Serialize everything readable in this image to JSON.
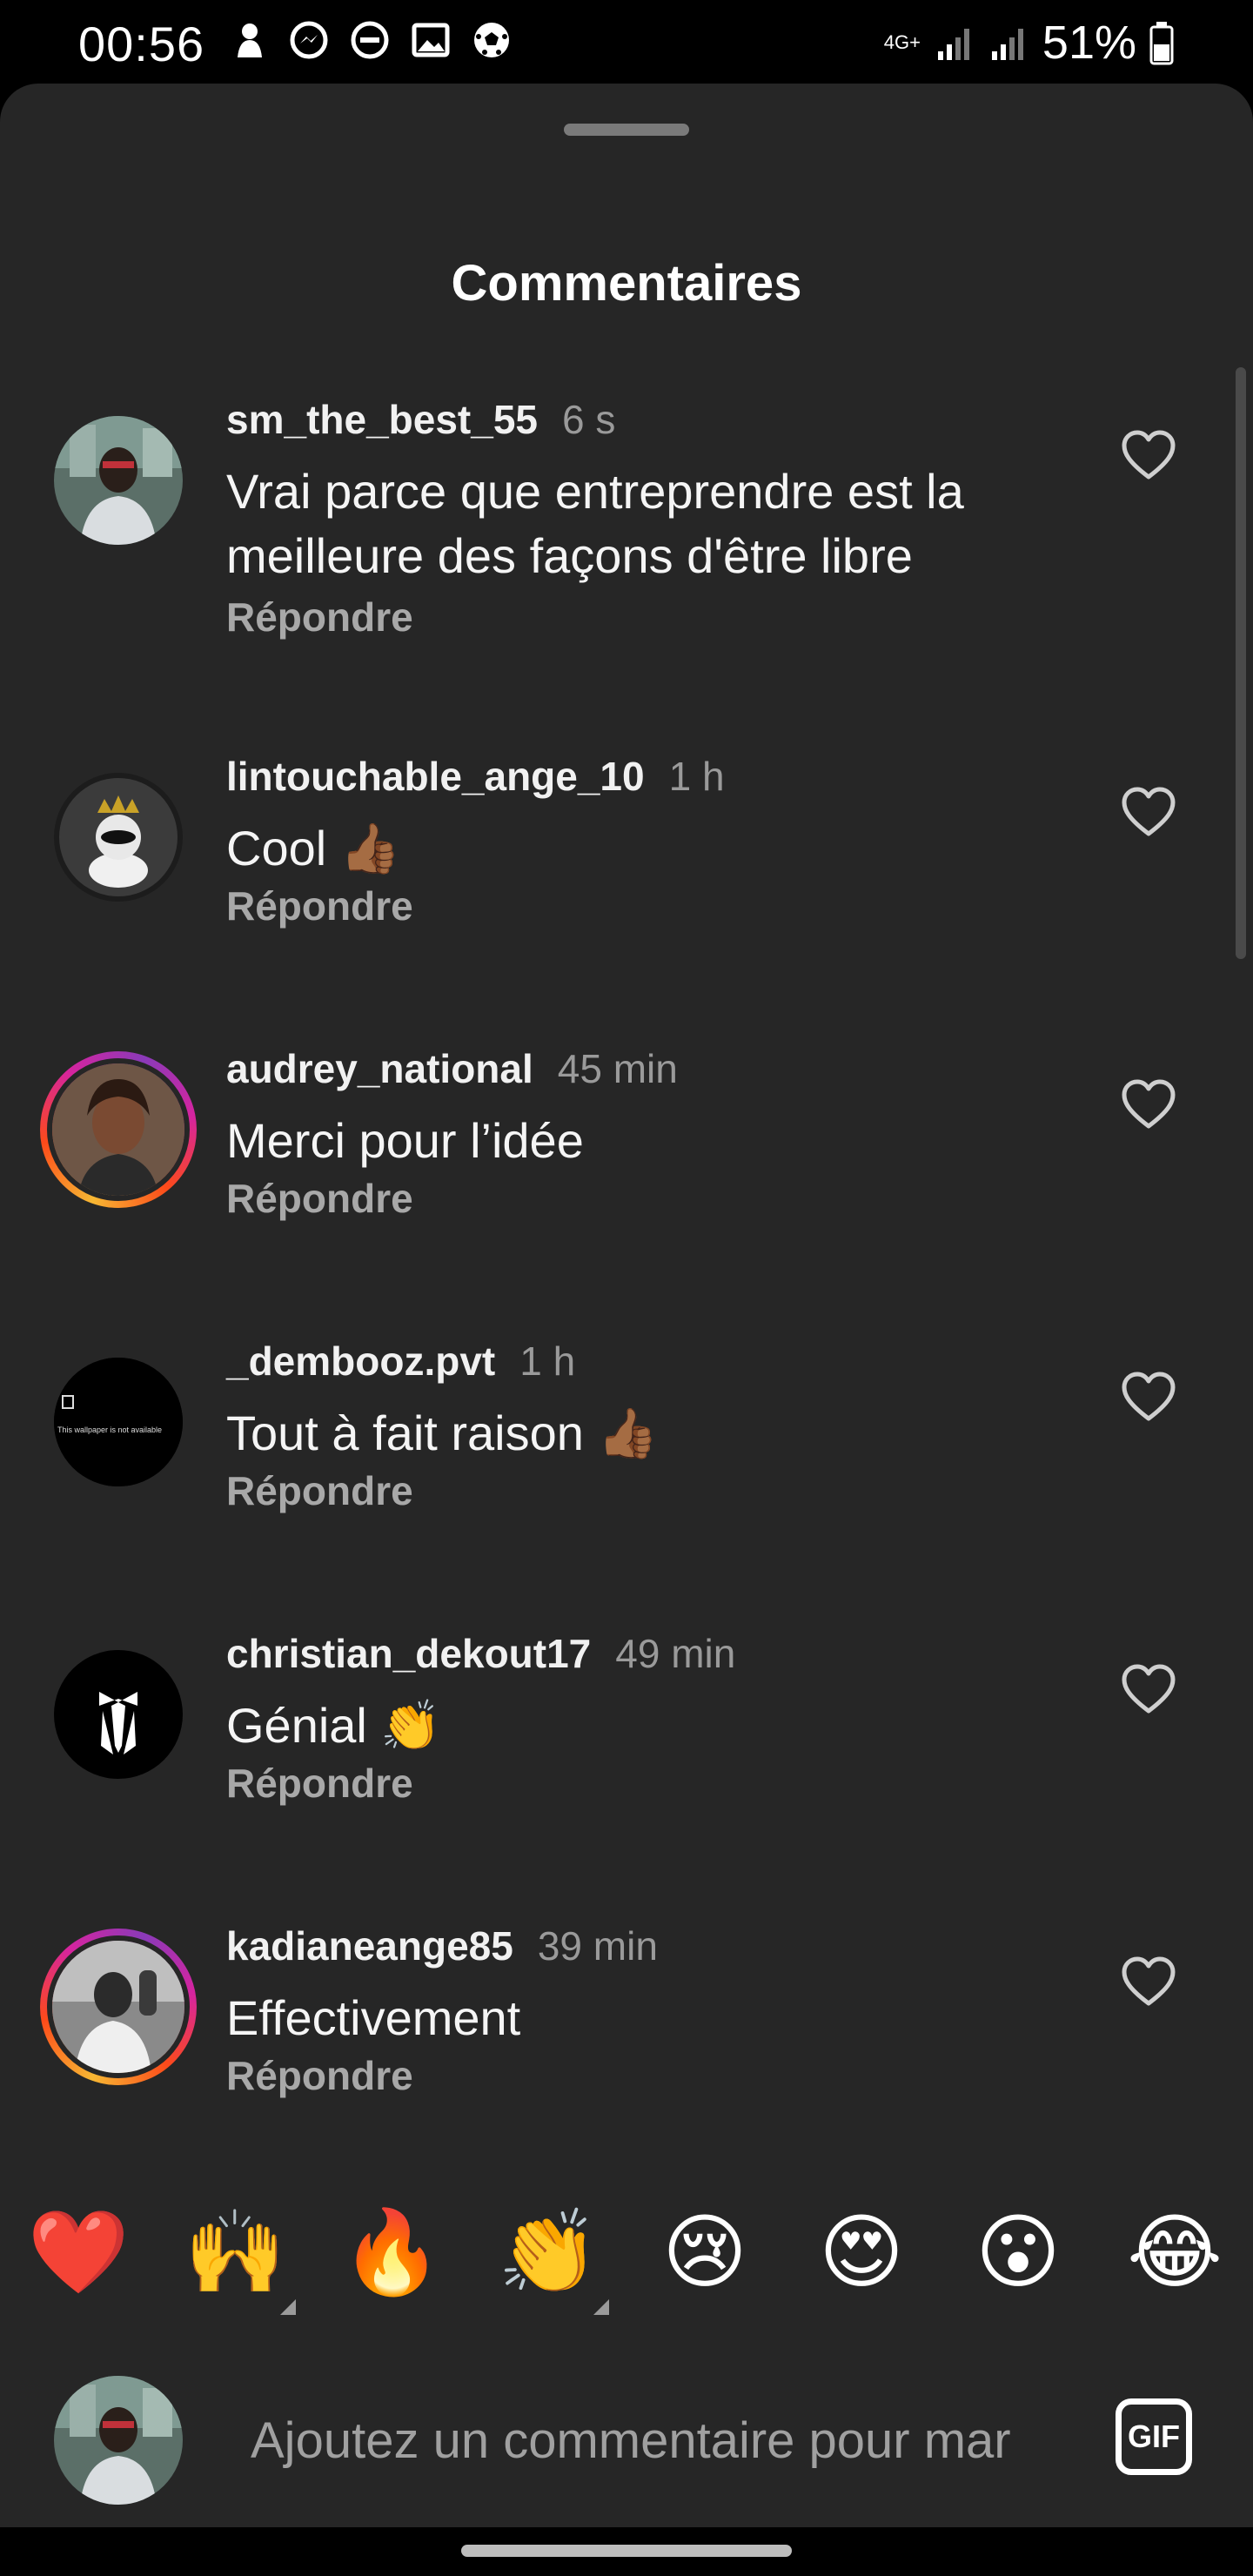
{
  "status_bar": {
    "time": "00:56",
    "network_label": "4G+",
    "battery_percent": "51%",
    "left_icons": [
      "dog-notification-icon",
      "messenger-icon",
      "do-not-disturb-icon",
      "gallery-icon",
      "soccer-ball-icon"
    ],
    "right_icons": [
      "signal-icon",
      "signal-icon-2",
      "battery-icon"
    ]
  },
  "sheet": {
    "title": "Commentaires"
  },
  "comments": [
    {
      "username": "sm_the_best_55",
      "time": "6 s",
      "text": "Vrai parce que entreprendre est la meilleure des façons d'être libre",
      "reply_label": "Répondre",
      "avatar_story_ring": false
    },
    {
      "username": "lintouchable_ange_10",
      "time": "1 h",
      "text": "Cool 👍🏾",
      "reply_label": "Répondre",
      "avatar_story_ring": false
    },
    {
      "username": "audrey_national",
      "time": "45 min",
      "text": "Merci pour l’idée",
      "reply_label": "Répondre",
      "avatar_story_ring": true
    },
    {
      "username": "_dembooz.pvt",
      "time": "1 h",
      "text": "Tout à fait raison 👍🏾",
      "reply_label": "Répondre",
      "avatar_story_ring": false,
      "avatar_text": "This wallpaper is not available"
    },
    {
      "username": "christian_dekout17",
      "time": "49 min",
      "text": "Génial 👏",
      "reply_label": "Répondre",
      "avatar_story_ring": false
    },
    {
      "username": "kadianeange85",
      "time": "39 min",
      "text": "Effectivement",
      "reply_label": "Répondre",
      "avatar_story_ring": true
    }
  ],
  "quick_reactions": [
    "❤️",
    "🙌",
    "🔥",
    "👏",
    "😢",
    "😍",
    "😮",
    "😂"
  ],
  "composer": {
    "placeholder": "Ajoutez un commentaire pour mar",
    "gif_label": "GIF"
  },
  "colors": {
    "sheet_background": "#262626",
    "secondary_text": "#9a9a9a",
    "story_ring": "#d6249f"
  }
}
